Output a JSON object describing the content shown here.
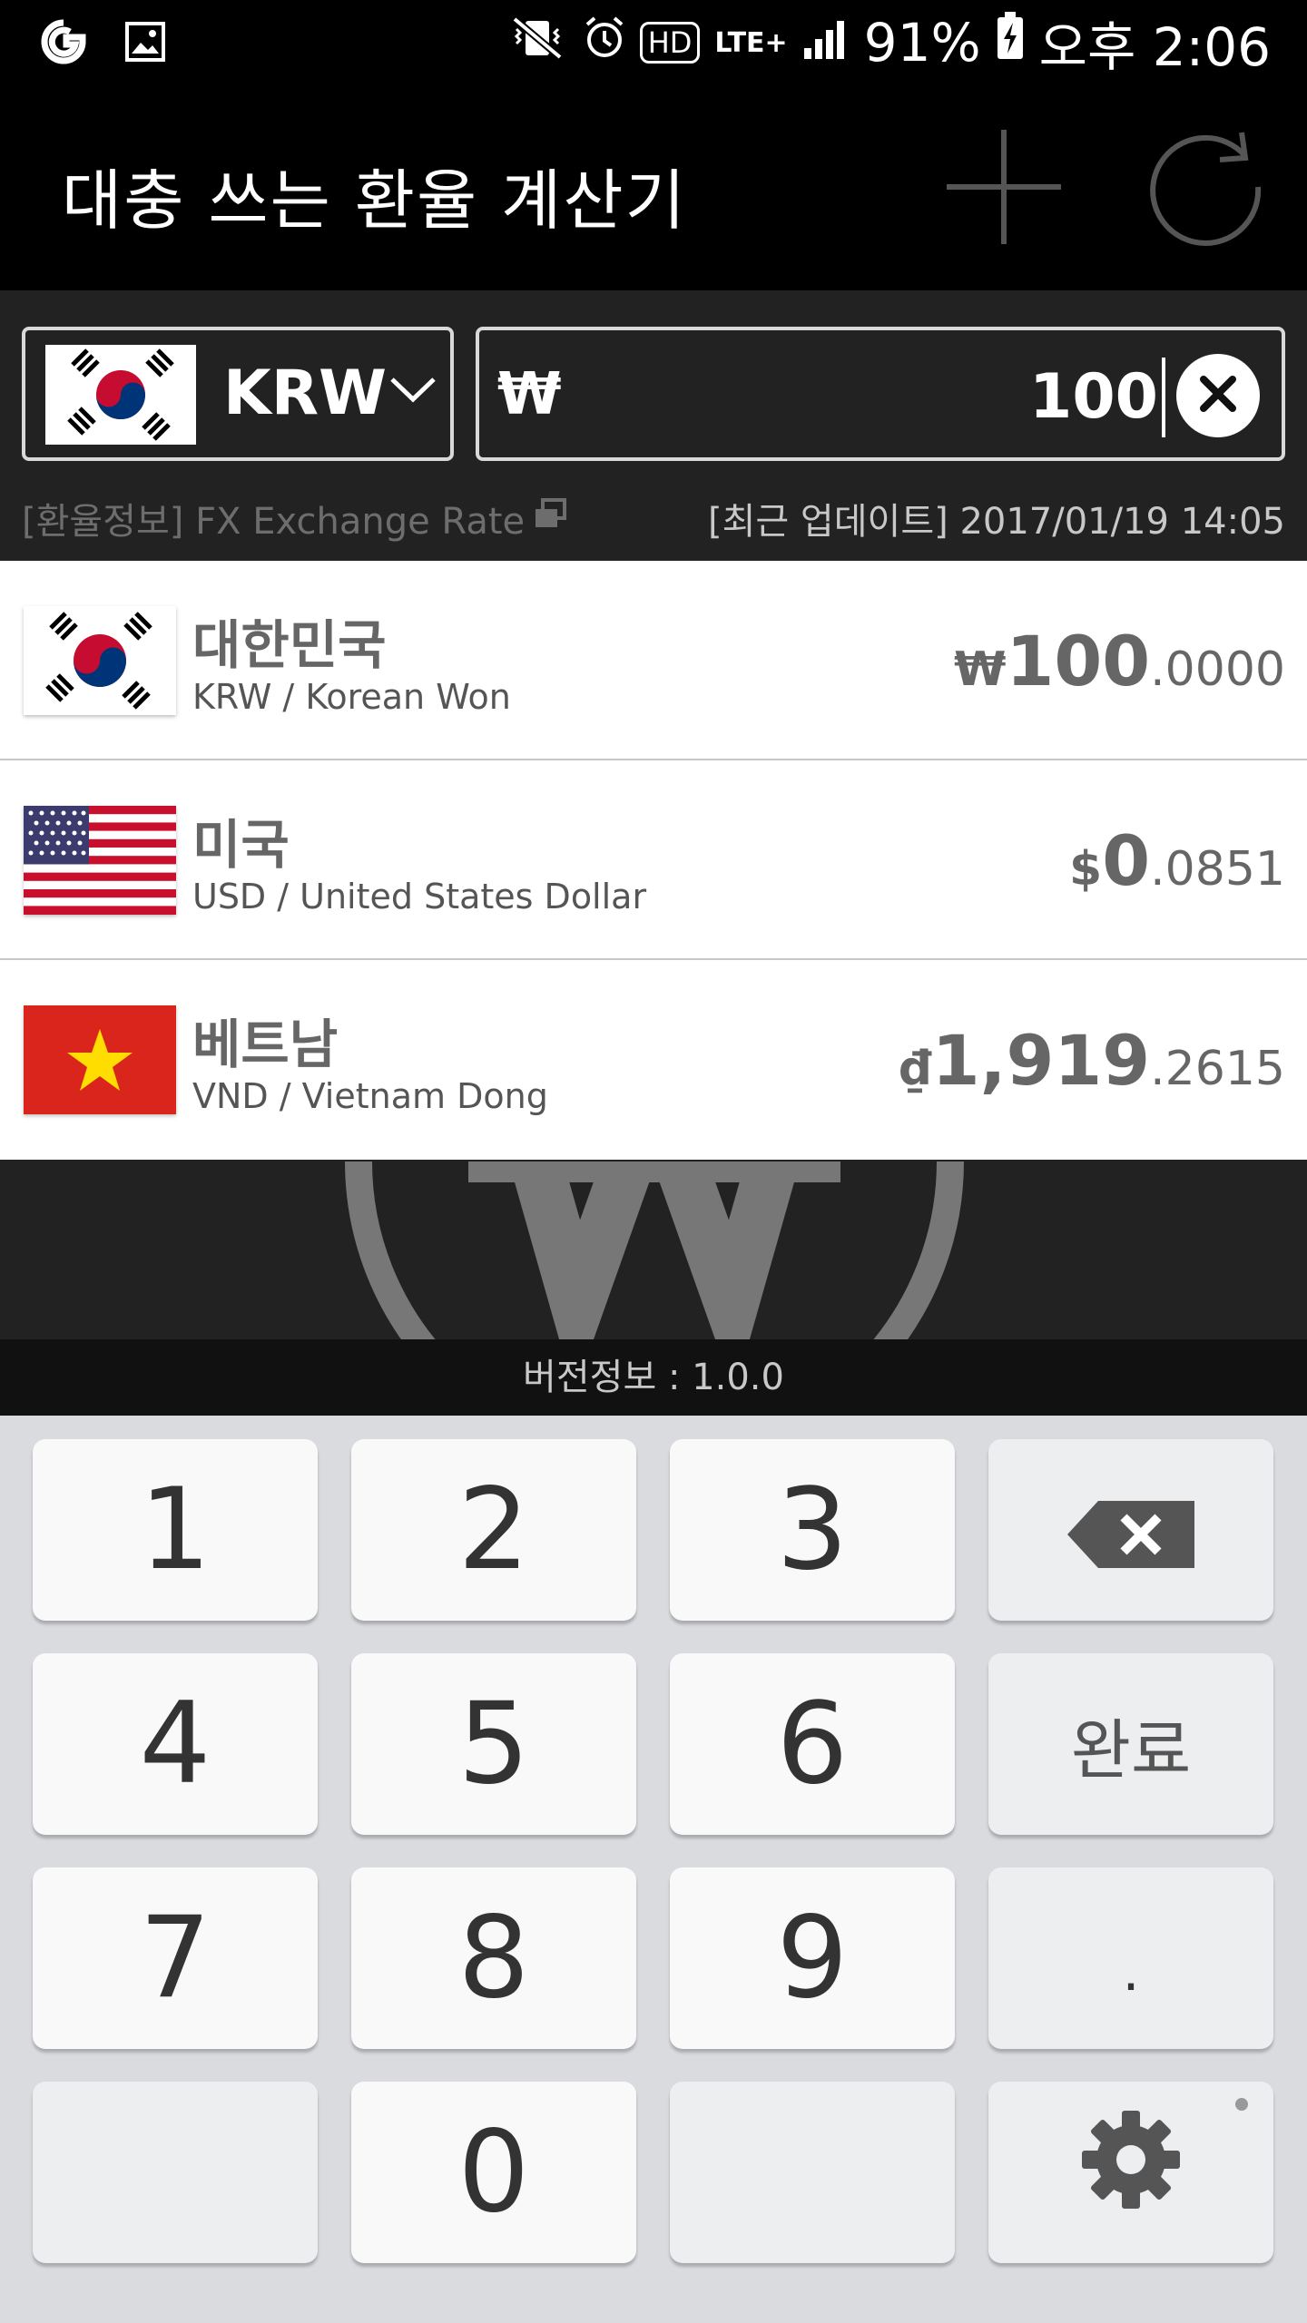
{
  "status_bar": {
    "battery_percent": "91%",
    "time": "오후 2:06",
    "hd_label": "HD",
    "network_label": "LTE+",
    "icons": [
      "app-g-icon",
      "gallery-icon",
      "vibrate-mute-icon",
      "alarm-icon",
      "hd-voice-icon",
      "lte-plus-icon",
      "signal-icon",
      "battery-charging-icon"
    ]
  },
  "app_bar": {
    "title": "대충 쓰는 환율 계산기",
    "actions": [
      "add-icon",
      "refresh-icon"
    ]
  },
  "input": {
    "currency_code": "KRW",
    "currency_symbol": "₩",
    "amount": "100"
  },
  "info": {
    "rate_link": "[환율정보] FX Exchange Rate",
    "last_update": "[최근 업데이트] 2017/01/19 14:05"
  },
  "conversions": [
    {
      "name": "대한민국",
      "sub": "KRW / Korean Won",
      "symbol": "₩",
      "integer": "100",
      "decimal": ".0000",
      "flag": "kr-flag-icon"
    },
    {
      "name": "미국",
      "sub": "USD / United States Dollar",
      "symbol": "$",
      "integer": "0",
      "decimal": ".0851",
      "flag": "us-flag-icon"
    },
    {
      "name": "베트남",
      "sub": "VND / Vietnam Dong",
      "symbol": "₫",
      "integer": "1,919",
      "decimal": ".2615",
      "flag": "vn-flag-icon"
    }
  ],
  "version": "버전정보 : 1.0.0",
  "keypad": {
    "keys": {
      "k1": "1",
      "k2": "2",
      "k3": "3",
      "k4": "4",
      "k5": "5",
      "k6": "6",
      "k7": "7",
      "k8": "8",
      "k9": "9",
      "k0": "0",
      "done": "완료",
      "dot": "."
    }
  },
  "colors": {
    "dark_bg": "#222222",
    "black": "#000000",
    "text_gray": "#666666",
    "keypad_bg": "#d9dbdf"
  }
}
